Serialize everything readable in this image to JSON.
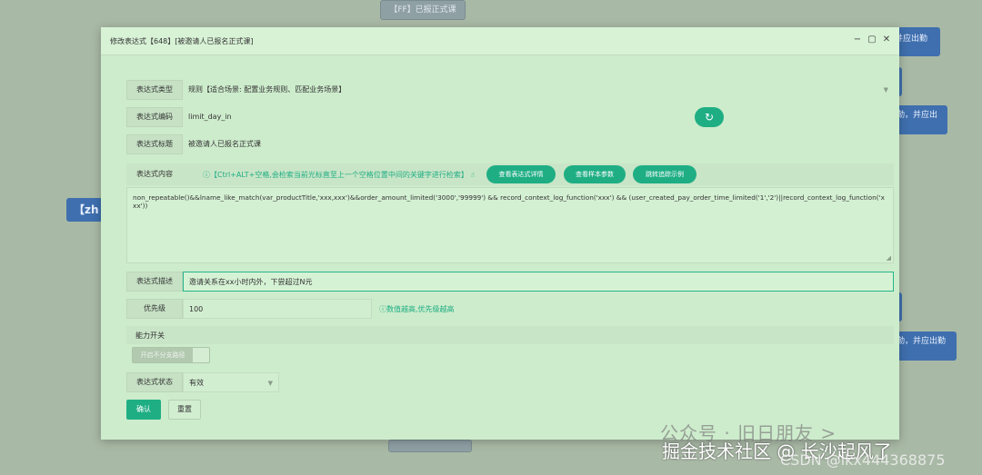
{
  "background": {
    "top_node": "【FF】已报正式课",
    "left_node": "【zh",
    "right_node_1": "并应出勤",
    "right_node_3": "勤，并应出",
    "right_node_5": "勤，并应出勤"
  },
  "dialog": {
    "title": "修改表达式【648】[被邀请人已报名正式课]",
    "minimize": "−",
    "maximize": "▢",
    "close": "✕"
  },
  "form": {
    "type_label": "表达式类型",
    "type_value": "规则【适合场景: 配置业务规则、匹配业务场景】",
    "code_label": "表达式编码",
    "code_value": "limit_day_in",
    "refresh_icon": "↻",
    "title_label": "表达式标题",
    "title_value": "被邀请人已报名正式课",
    "content_label": "表达式内容",
    "content_hint": "ⓘ【Ctrl+ALT+空格,会检索当前光标直至上一个空格位置中间的关键字进行检索】 ☝",
    "btn_detail": "查看表达式详情",
    "btn_sample": "查看样本参数",
    "btn_jump": "跳转追踪示例",
    "content_value": "non_repeatable()&&lname_like_match(var_productTitle,'xxx,xxx')&&order_amount_limited('3000','99999') && record_context_log_function('xxx') && (user_created_pay_order_time_limited('1','2')||record_context_log_function('xxx'))",
    "desc_label": "表达式描述",
    "desc_value": "邀请关系在xx小时内外，下尝超过N元",
    "priority_label": "优先级",
    "priority_value": "100",
    "priority_hint": "ⓘ数值越高,优先级越高",
    "ability_label": "能力开关",
    "toggle_label": "开启不分支路径",
    "status_label": "表达式状态",
    "status_value": "有效",
    "confirm": "确认",
    "reset": "重置"
  },
  "watermark": {
    "line1": "公众号 · 旧日朋友 >",
    "line2": "掘金技术社区 @ 长沙起风了",
    "line3": "CSDN @lkx444368875"
  },
  "colors": {
    "accent": "#1fae84",
    "dialog_bg": "#cdeccc",
    "overlay": "#a8b9a5"
  }
}
